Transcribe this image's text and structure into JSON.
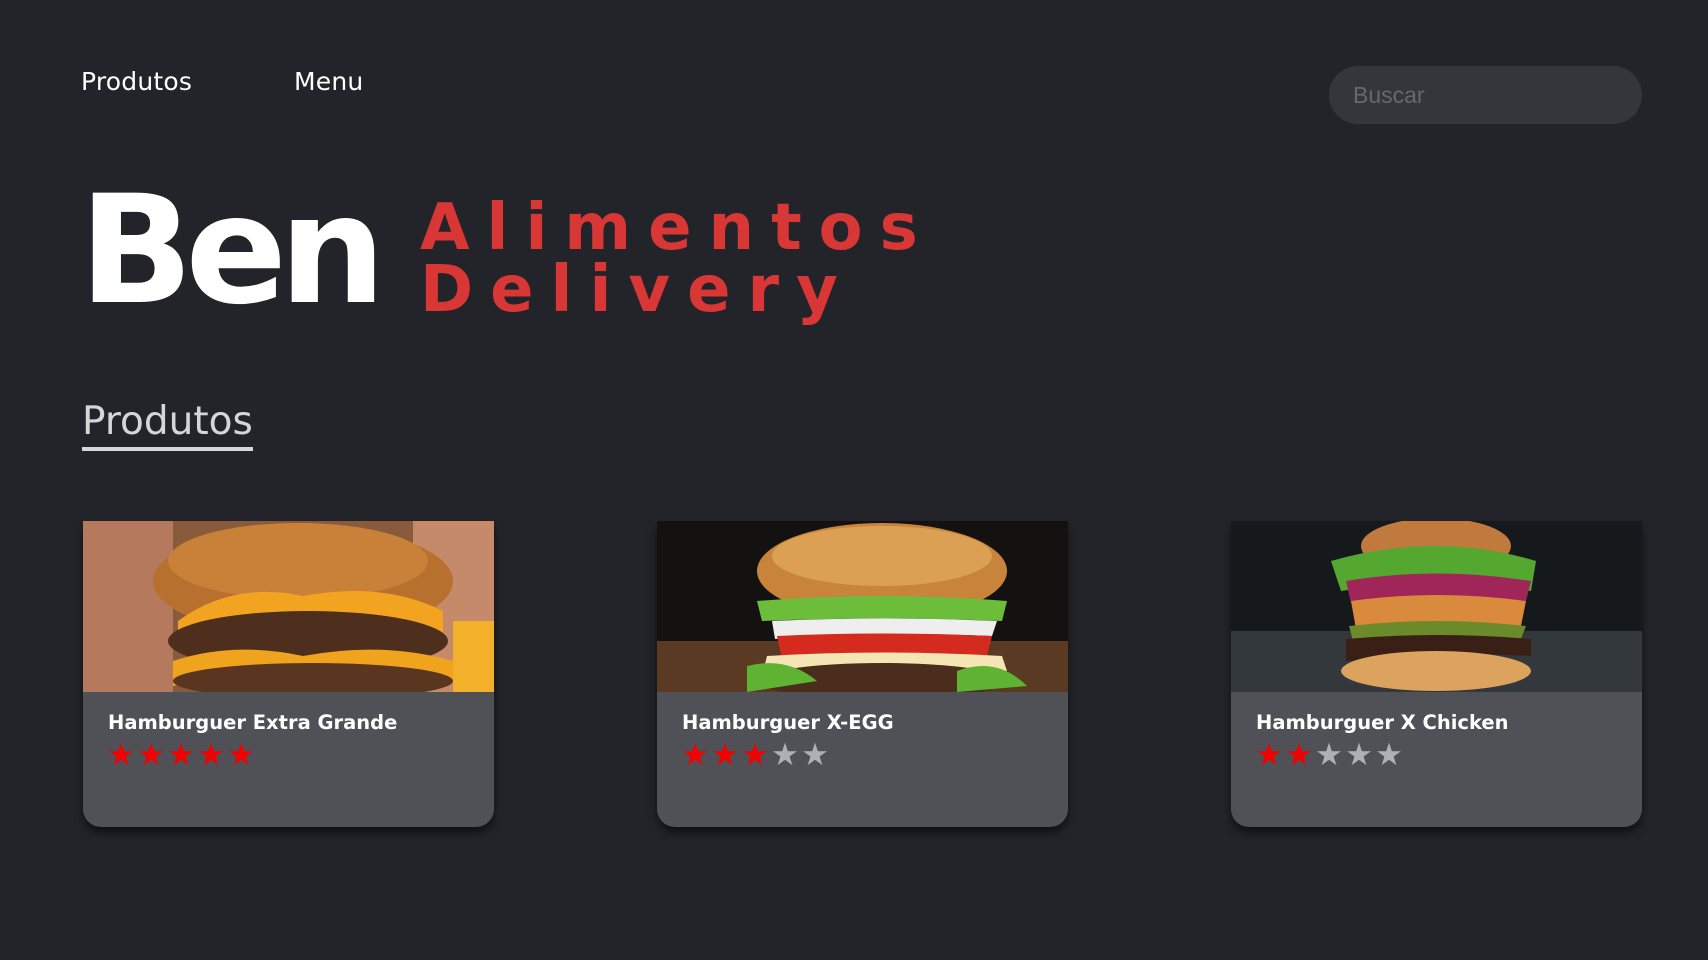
{
  "nav": {
    "items": [
      {
        "label": "Produtos"
      },
      {
        "label": "Menu"
      }
    ]
  },
  "search": {
    "placeholder": "Buscar",
    "value": ""
  },
  "hero": {
    "brand": "Ben",
    "tagline_line1": "Alimentos",
    "tagline_line2": "Delivery"
  },
  "section": {
    "title": "Produtos"
  },
  "colors": {
    "background": "#23242a",
    "card": "#505156",
    "accent": "#d93636",
    "star_filled": "#f40000",
    "star_empty": "#b0b0b3"
  },
  "products": [
    {
      "name": "Hamburguer Extra Grande",
      "rating": 5,
      "max_rating": 5,
      "image": "burger-photo"
    },
    {
      "name": "Hamburguer X-EGG",
      "rating": 3,
      "max_rating": 5,
      "image": "burger-photo"
    },
    {
      "name": "Hamburguer X Chicken",
      "rating": 2,
      "max_rating": 5,
      "image": "burger-photo"
    }
  ]
}
